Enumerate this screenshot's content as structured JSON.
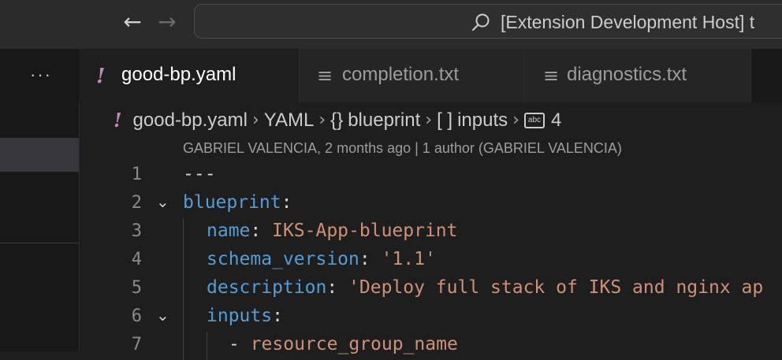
{
  "titlebar": {
    "back_icon": "arrow-left-icon",
    "forward_icon": "arrow-right-icon",
    "search_icon": "search-icon",
    "command_center_text": "[Extension Development Host] t"
  },
  "sidebar": {
    "more_label": "···"
  },
  "tabs": [
    {
      "label": "good-bp.yaml",
      "icon": "!",
      "active": true
    },
    {
      "label": "completion.txt",
      "icon": "≡",
      "active": false
    },
    {
      "label": "diagnostics.txt",
      "icon": "≡",
      "active": false
    }
  ],
  "breadcrumb": {
    "file_icon": "!",
    "file": "good-bp.yaml",
    "lang": "YAML",
    "obj_icon": "{}",
    "obj": "blueprint",
    "arr_icon": "[ ]",
    "arr": "inputs",
    "str_icon": "abc",
    "item": "4"
  },
  "blame": "GABRIEL VALENCIA, 2 months ago | 1 author (GABRIEL VALENCIA)",
  "code": {
    "lines": [
      {
        "n": "1",
        "key": "",
        "colon": "",
        "value": "",
        "raw": "---"
      },
      {
        "n": "2",
        "key": "blueprint",
        "colon": ":",
        "value": "",
        "raw": ""
      },
      {
        "n": "3",
        "key": "name",
        "colon": ": ",
        "value": "IKS-App-blueprint",
        "raw": ""
      },
      {
        "n": "4",
        "key": "schema_version",
        "colon": ": ",
        "value": "'1.1'",
        "raw": ""
      },
      {
        "n": "5",
        "key": "description",
        "colon": ": ",
        "value": "'Deploy full stack of IKS and nginx ap",
        "raw": ""
      },
      {
        "n": "6",
        "key": "inputs",
        "colon": ":",
        "value": "",
        "raw": ""
      },
      {
        "n": "7",
        "key": "",
        "colon": "",
        "value": "resource_group_name",
        "raw": "- "
      }
    ]
  },
  "colors": {
    "key": "#569cd6",
    "string": "#ce9178",
    "punct": "#d4d4d4",
    "badge": "#c586c0"
  }
}
